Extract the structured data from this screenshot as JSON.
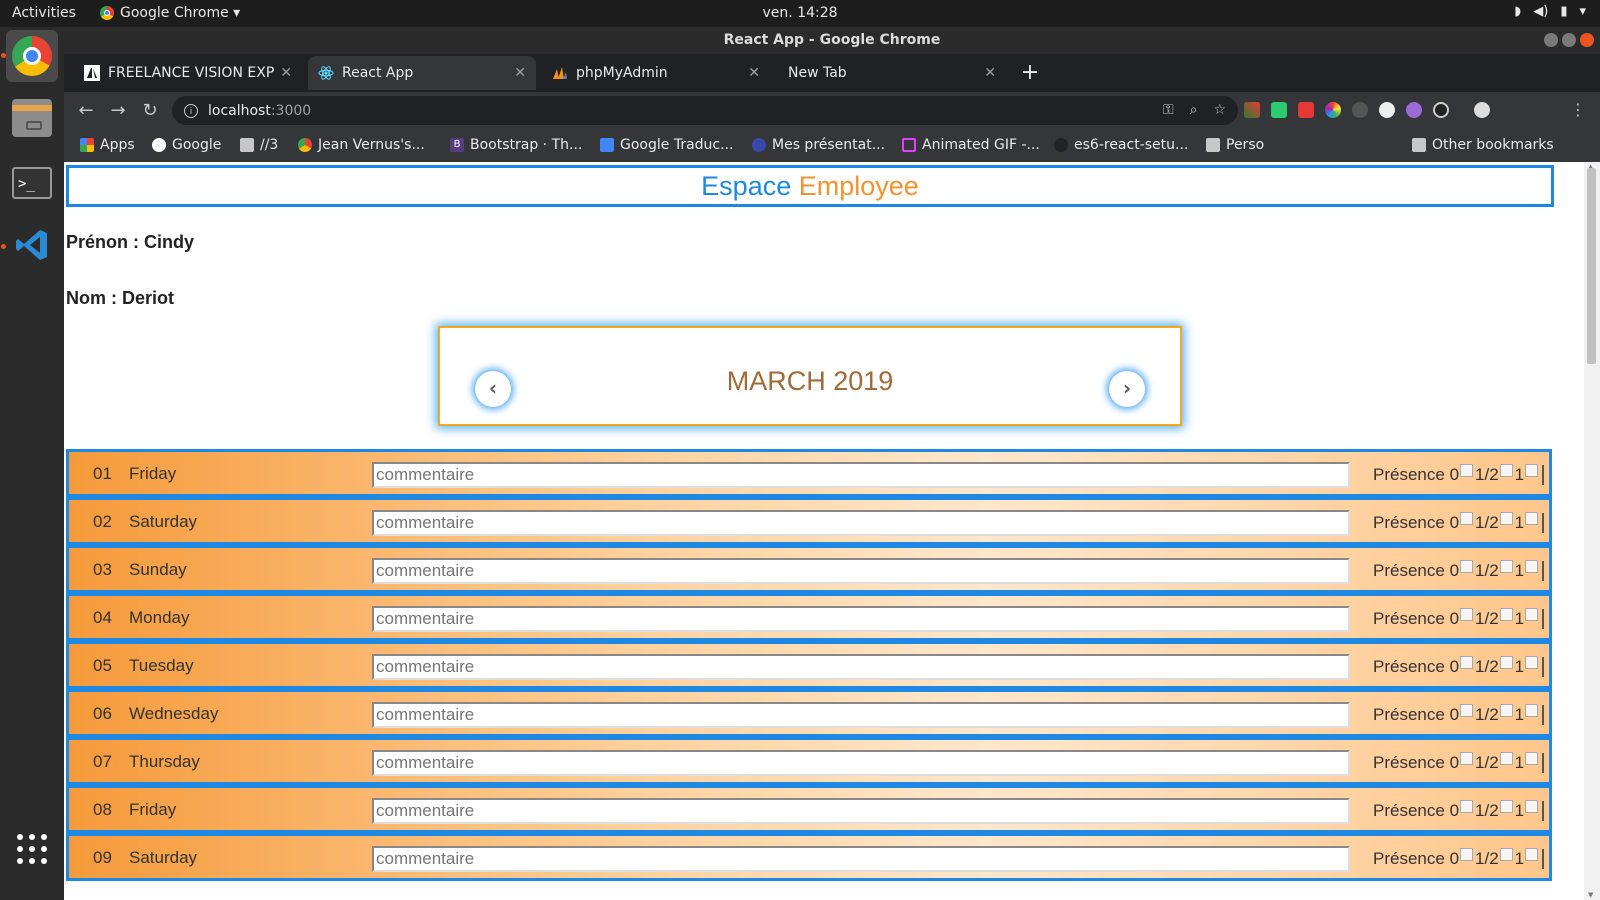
{
  "os": {
    "activities": "Activities",
    "app_menu": "Google Chrome ▾",
    "clock": "ven. 14:28",
    "sys_icons": [
      "wifi-icon",
      "volume-icon",
      "battery-icon",
      "menu-caret-icon"
    ]
  },
  "window": {
    "title": "React App - Google Chrome"
  },
  "tabs": [
    {
      "label": "FREELANCE VISION EXPE",
      "icon": "freelance-icon",
      "active": false
    },
    {
      "label": "React App",
      "icon": "react-icon",
      "active": true
    },
    {
      "label": "phpMyAdmin",
      "icon": "phpmyadmin-icon",
      "active": false
    },
    {
      "label": "New Tab",
      "icon": "",
      "active": false
    }
  ],
  "omnibox": {
    "host": "localhost",
    "port": ":3000"
  },
  "bookmarks": [
    {
      "label": "Apps",
      "icon": "apps-grid-icon"
    },
    {
      "label": "Google",
      "icon": "google-icon"
    },
    {
      "label": "//3",
      "icon": "folder-icon"
    },
    {
      "label": "Jean Vernus's...",
      "icon": "chrome-icon"
    },
    {
      "label": "Bootstrap · Th...",
      "icon": "bootstrap-icon"
    },
    {
      "label": "Google Traduc...",
      "icon": "translate-icon"
    },
    {
      "label": "Mes présentat...",
      "icon": "globe-icon"
    },
    {
      "label": "Animated GIF -...",
      "icon": "document-icon"
    },
    {
      "label": "es6-react-setu...",
      "icon": "github-icon"
    },
    {
      "label": "Perso",
      "icon": "folder-icon"
    }
  ],
  "other_bookmarks": "Other bookmarks",
  "app": {
    "title_part1": "Espace",
    "title_part2": "Employee",
    "first_name_label": "Prénon : Cindy",
    "last_name_label": "Nom : Deriot",
    "month_label": "MARCH 2019",
    "comment_placeholder": "commentaire",
    "presence_label": "Présence",
    "presence_opt0": "0",
    "presence_opt_half": "1/2",
    "presence_opt1": "1"
  },
  "days": [
    {
      "num": "01",
      "name": "Friday"
    },
    {
      "num": "02",
      "name": "Saturday"
    },
    {
      "num": "03",
      "name": "Sunday"
    },
    {
      "num": "04",
      "name": "Monday"
    },
    {
      "num": "05",
      "name": "Tuesday"
    },
    {
      "num": "06",
      "name": "Wednesday"
    },
    {
      "num": "07",
      "name": "Thursday"
    },
    {
      "num": "08",
      "name": "Friday"
    },
    {
      "num": "09",
      "name": "Saturday"
    }
  ],
  "colors": {
    "blue": "#1e88e5",
    "orange": "#f5922f",
    "month_text": "#a06a3a"
  }
}
